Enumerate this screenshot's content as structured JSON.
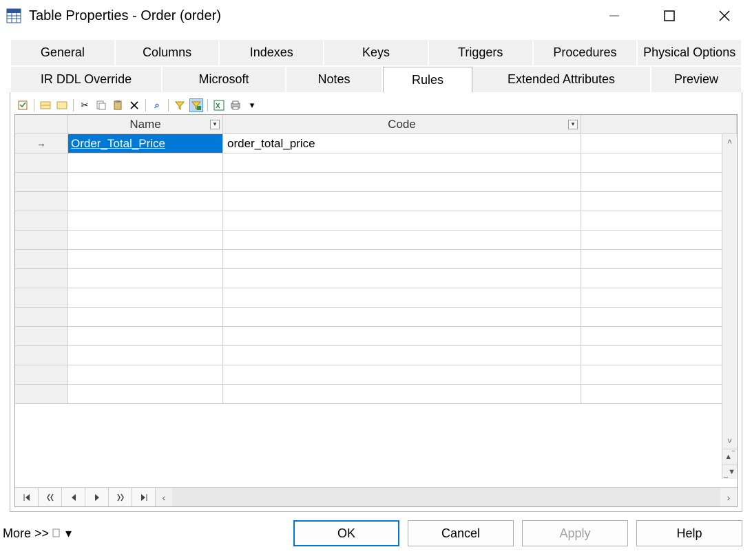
{
  "window": {
    "title": "Table Properties - Order (order)"
  },
  "tabs_row1": [
    "General",
    "Columns",
    "Indexes",
    "Keys",
    "Triggers",
    "Procedures",
    "Physical Options"
  ],
  "tabs_row2": [
    "IR DDL Override",
    "Microsoft",
    "Notes",
    "Rules",
    "Extended Attributes",
    "Preview"
  ],
  "active_tab": "Rules",
  "grid": {
    "columns": {
      "name": "Name",
      "code": "Code"
    },
    "rows": [
      {
        "name": "Order_Total_Price",
        "code": "order_total_price"
      }
    ],
    "blank_rows": 13
  },
  "footer": {
    "more": "More >>",
    "ok": "OK",
    "cancel": "Cancel",
    "apply": "Apply",
    "help": "Help"
  }
}
